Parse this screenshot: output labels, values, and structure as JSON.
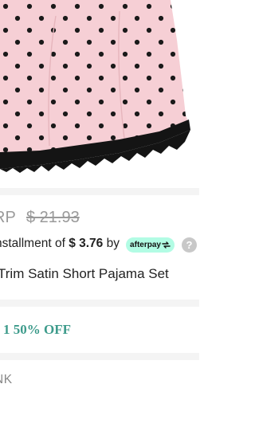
{
  "product": {
    "msrp_label": "RP",
    "msrp_value": "$ 21.93",
    "installment_prefix": "nstallment of",
    "installment_amount": "$ 3.76",
    "installment_by": "by",
    "afterpay_label": "afterpay",
    "help_glyph": "?",
    "title": "Trim Satin Short Pajama Set"
  },
  "promo": {
    "text": "1 50% OFF"
  },
  "color": {
    "label": "NK"
  },
  "colors": {
    "fabric": "#f6cfd5",
    "dots": "#1a1a1a",
    "lace": "#141414",
    "afterpay": "#b2fce4",
    "promo": "#3d9b8b"
  },
  "icons": {
    "afterpay": "afterpay-arrows-icon",
    "help": "question-mark-icon"
  }
}
